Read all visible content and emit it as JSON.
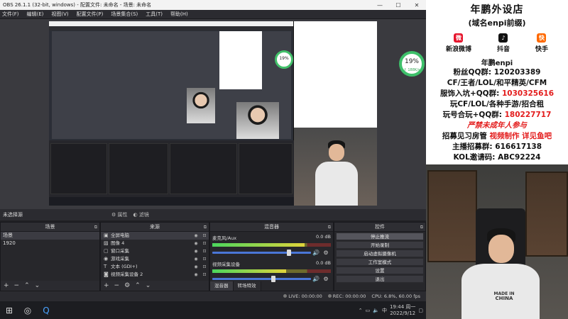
{
  "window": {
    "title": "OBS 26.1.1 (32-bit, windows) - 配置文件: 未命名 - 场景: 未命名"
  },
  "menu": [
    "文件(F)",
    "编辑(E)",
    "视图(V)",
    "配置文件(P)",
    "场景集合(S)",
    "工具(T)",
    "帮助(H)"
  ],
  "scene_bar": {
    "current_scene": "未选择源",
    "properties": "属性",
    "filters": "滤镜"
  },
  "scenes_dock": {
    "title": "场景",
    "items": [
      "场景",
      "1920"
    ]
  },
  "sources_dock": {
    "title": "来源",
    "items": [
      {
        "icon": "display-icon",
        "glyph": "▣",
        "label": "全屏电脑"
      },
      {
        "icon": "image-icon",
        "glyph": "▨",
        "label": "图像 4"
      },
      {
        "icon": "window-icon",
        "glyph": "▢",
        "label": "窗口采集"
      },
      {
        "icon": "game-icon",
        "glyph": "◉",
        "label": "游戏采集"
      },
      {
        "icon": "text-icon",
        "glyph": "T",
        "label": "文本 (GDI+)"
      },
      {
        "icon": "camera-icon",
        "glyph": "◙",
        "label": "视频采集设备 2"
      }
    ]
  },
  "mixer_dock": {
    "title": "混音器",
    "channels": [
      {
        "name": "麦克风/Aux",
        "db": "0.0 dB",
        "level": 0.78
      },
      {
        "name": "视频采集设备",
        "db": "0.0 dB",
        "level": 0.62
      }
    ],
    "tabs": [
      "混音器",
      "转场特效"
    ]
  },
  "controls_dock": {
    "title": "控件",
    "buttons": [
      "停止推流",
      "开始录制",
      "启动虚拟摄像机",
      "工作室模式",
      "设置",
      "退出"
    ]
  },
  "status": {
    "live": "LIVE: 00:00:00",
    "rec": "REC: 00:00:00",
    "cpu": "CPU: 6.8%, 60.00 fps"
  },
  "taskbar": {
    "time": "19:44 周一",
    "date": "2022/9/12"
  },
  "gauge": {
    "value": "19%",
    "rate": "↑ 188K/s"
  },
  "promo": {
    "title": "年鹏外设店",
    "subtitle": "(域名enpi前缀)",
    "socials": [
      {
        "icon": "weibo-icon",
        "label": "新浪微博",
        "color": "#e6162d",
        "glyph": "微"
      },
      {
        "icon": "douyin-icon",
        "label": "抖音",
        "color": "#111111",
        "glyph": "♪"
      },
      {
        "icon": "kuaishou-icon",
        "label": "快手",
        "color": "#ff6a00",
        "glyph": "快"
      }
    ],
    "handle": "年鹏enpi",
    "lines": [
      {
        "text": "粉丝QQ群: 120203389",
        "red": false
      },
      {
        "text": "CF/王者/LOL/和平精英/CFM",
        "red": false
      },
      {
        "text": "服饰入坑+QQ群: 1030325616",
        "red": false,
        "red_part": "1030325616"
      },
      {
        "text": "玩CF/LOL/各种手游/招合租",
        "red": false
      },
      {
        "text": "玩号合玩+QQ群: 180227717",
        "red": false,
        "red_part": "180227717"
      },
      {
        "text": "严禁未成年人参与",
        "red": true
      },
      {
        "text": "招募见习房管 视频制作 详见鱼吧",
        "red": false,
        "mixed": true
      },
      {
        "text": "主播招募群: 616617138",
        "red": false
      },
      {
        "text": "KOL邀请码: ABC92224",
        "red": false
      }
    ]
  },
  "shirt": {
    "line1": "MADE IN",
    "line2": "CHINA"
  }
}
